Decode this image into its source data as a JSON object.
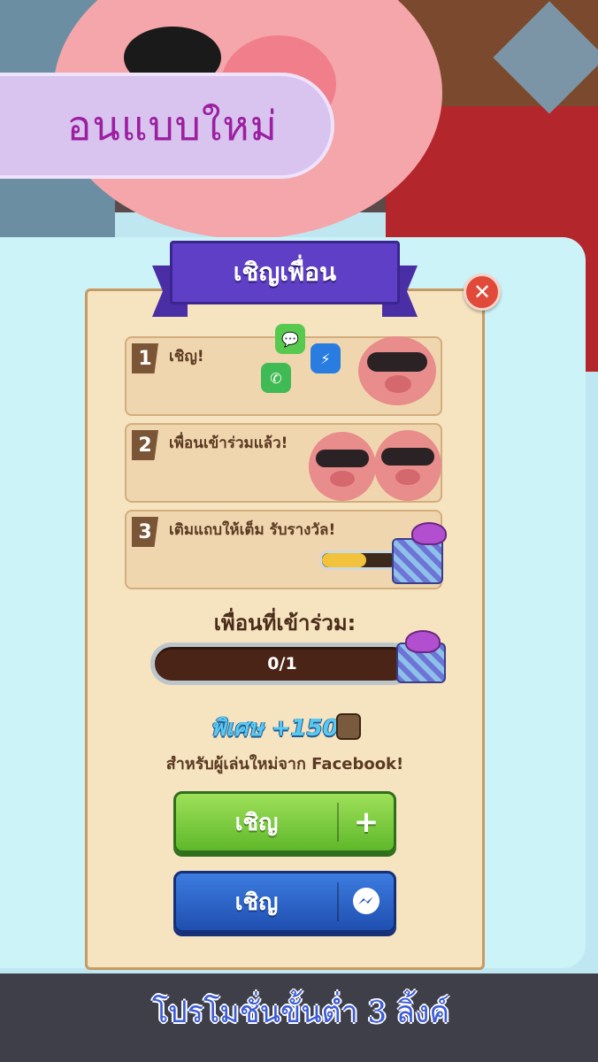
{
  "promo_banner": {
    "text": "อนแบบใหม่"
  },
  "dialog": {
    "title": "เชิญเพื่อน",
    "close_icon": "close-icon",
    "steps": [
      {
        "number": "1",
        "label": "เชิญ!"
      },
      {
        "number": "2",
        "label": "เพื่อนเข้าร่วมแล้ว!"
      },
      {
        "number": "3",
        "label": "เติมแถบให้เต็ม รับรางวัล!"
      }
    ],
    "friends_joined_label": "เพื่อนที่เข้าร่วม:",
    "progress": {
      "text": "0/1",
      "current": 0,
      "total": 1
    },
    "step3_bar_fraction": 0.6,
    "bonus_label": "พิเศษ +150",
    "facebook_note": "สำหรับผู้เล่นใหม่จาก Facebook!",
    "invite_button_label": "เชิญ",
    "invite_plus_icon": "+",
    "messenger_button_label": "เชิญ"
  },
  "footer": {
    "text": "โปรโมชั่นขั้นต่ำ 3 ลิ้งค์"
  },
  "colors": {
    "ribbon": "#5e3fc6",
    "green_button": "#5fb82a",
    "blue_button": "#1f4fb0",
    "close_button": "#e14a3a"
  }
}
